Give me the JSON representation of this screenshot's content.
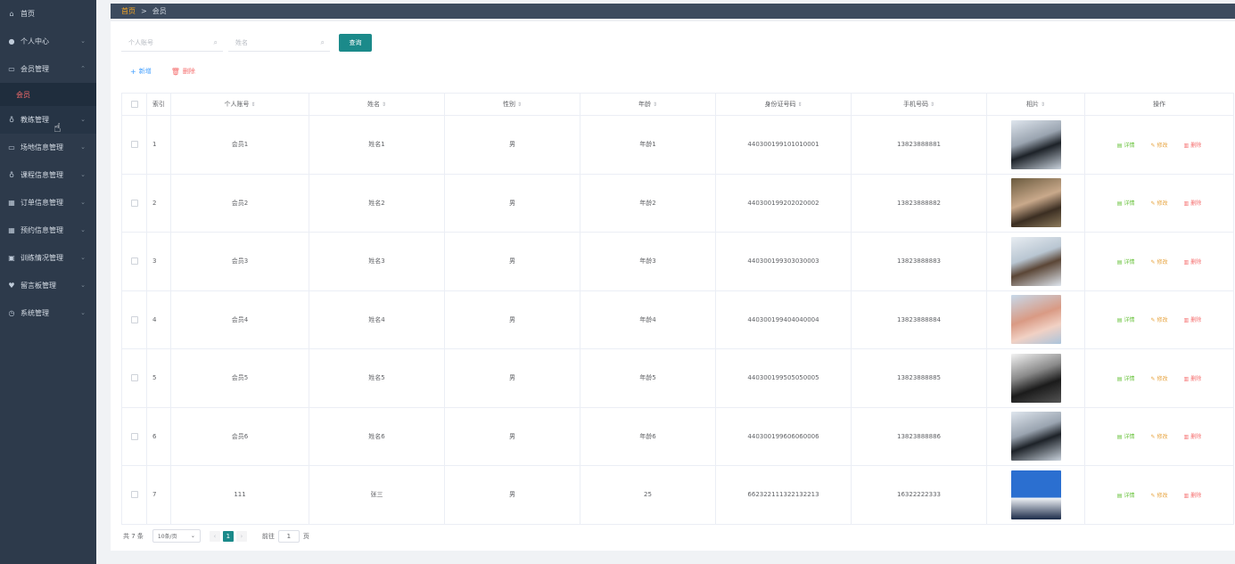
{
  "sidebar": {
    "items": [
      {
        "label": "首页",
        "icon": "home-icon"
      },
      {
        "label": "个人中心",
        "icon": "user-icon"
      },
      {
        "label": "会员管理",
        "icon": "chat-icon"
      },
      {
        "label": "教练管理",
        "icon": "bulb-icon"
      },
      {
        "label": "场地信息管理",
        "icon": "chat-icon"
      },
      {
        "label": "课程信息管理",
        "icon": "bulb-icon"
      },
      {
        "label": "订单信息管理",
        "icon": "grid-icon"
      },
      {
        "label": "预约信息管理",
        "icon": "grid-icon"
      },
      {
        "label": "训练情况管理",
        "icon": "box-icon"
      },
      {
        "label": "留言板管理",
        "icon": "pin-icon"
      },
      {
        "label": "系统管理",
        "icon": "clock-icon"
      }
    ],
    "submenu_active": "会员"
  },
  "breadcrumb": {
    "home": "首页",
    "separator": ">",
    "current": "会员"
  },
  "search": {
    "account_placeholder": "个人账号",
    "name_placeholder": "姓名",
    "query_label": "查询"
  },
  "actions": {
    "add_label": "新增",
    "delete_label": "删除"
  },
  "table": {
    "headers": {
      "index": "索引",
      "account": "个人账号",
      "name": "姓名",
      "gender": "性别",
      "age": "年龄",
      "idcard": "身份证号码",
      "phone": "手机号码",
      "photo": "相片",
      "ops": "操作"
    },
    "rows": [
      {
        "index": "1",
        "account": "会员1",
        "name": "姓名1",
        "gender": "男",
        "age": "年龄1",
        "idcard": "440300199101010001",
        "phone": "13823888881"
      },
      {
        "index": "2",
        "account": "会员2",
        "name": "姓名2",
        "gender": "男",
        "age": "年龄2",
        "idcard": "440300199202020002",
        "phone": "13823888882"
      },
      {
        "index": "3",
        "account": "会员3",
        "name": "姓名3",
        "gender": "男",
        "age": "年龄3",
        "idcard": "440300199303030003",
        "phone": "13823888883"
      },
      {
        "index": "4",
        "account": "会员4",
        "name": "姓名4",
        "gender": "男",
        "age": "年龄4",
        "idcard": "440300199404040004",
        "phone": "13823888884"
      },
      {
        "index": "5",
        "account": "会员5",
        "name": "姓名5",
        "gender": "男",
        "age": "年龄5",
        "idcard": "440300199505050005",
        "phone": "13823888885"
      },
      {
        "index": "6",
        "account": "会员6",
        "name": "姓名6",
        "gender": "男",
        "age": "年龄6",
        "idcard": "440300199606060006",
        "phone": "13823888886"
      },
      {
        "index": "7",
        "account": "111",
        "name": "张三",
        "gender": "男",
        "age": "25",
        "idcard": "662322111322132213",
        "phone": "16322222333"
      }
    ],
    "op_labels": {
      "detail": "详情",
      "edit": "修改",
      "delete": "删除"
    }
  },
  "pagination": {
    "total": "共 7 条",
    "page_size": "10条/页",
    "current_page": "1",
    "goto_prefix": "前往",
    "goto_value": "1",
    "goto_suffix": "页"
  },
  "colors": {
    "sidebar_bg": "#2d3a4b",
    "accent": "#1b8a8a",
    "danger": "#f56c6c",
    "success": "#67c23a",
    "warning": "#e6a23c"
  }
}
